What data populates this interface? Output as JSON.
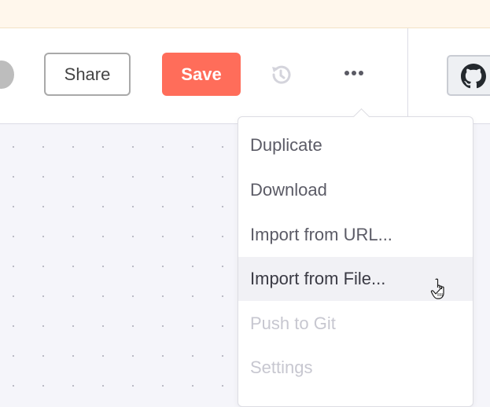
{
  "toolbar": {
    "share_label": "Share",
    "save_label": "Save",
    "save_color": "#ff6d5a",
    "history_icon": "history-icon",
    "more_icon": "more-horizontal-icon",
    "github_icon": "github-icon"
  },
  "menu": {
    "items": [
      {
        "label": "Duplicate",
        "state": "normal"
      },
      {
        "label": "Download",
        "state": "normal"
      },
      {
        "label": "Import from URL...",
        "state": "normal"
      },
      {
        "label": "Import from File...",
        "state": "hover"
      },
      {
        "label": "Push to Git",
        "state": "disabled"
      },
      {
        "label": "Settings",
        "state": "disabled"
      }
    ]
  }
}
